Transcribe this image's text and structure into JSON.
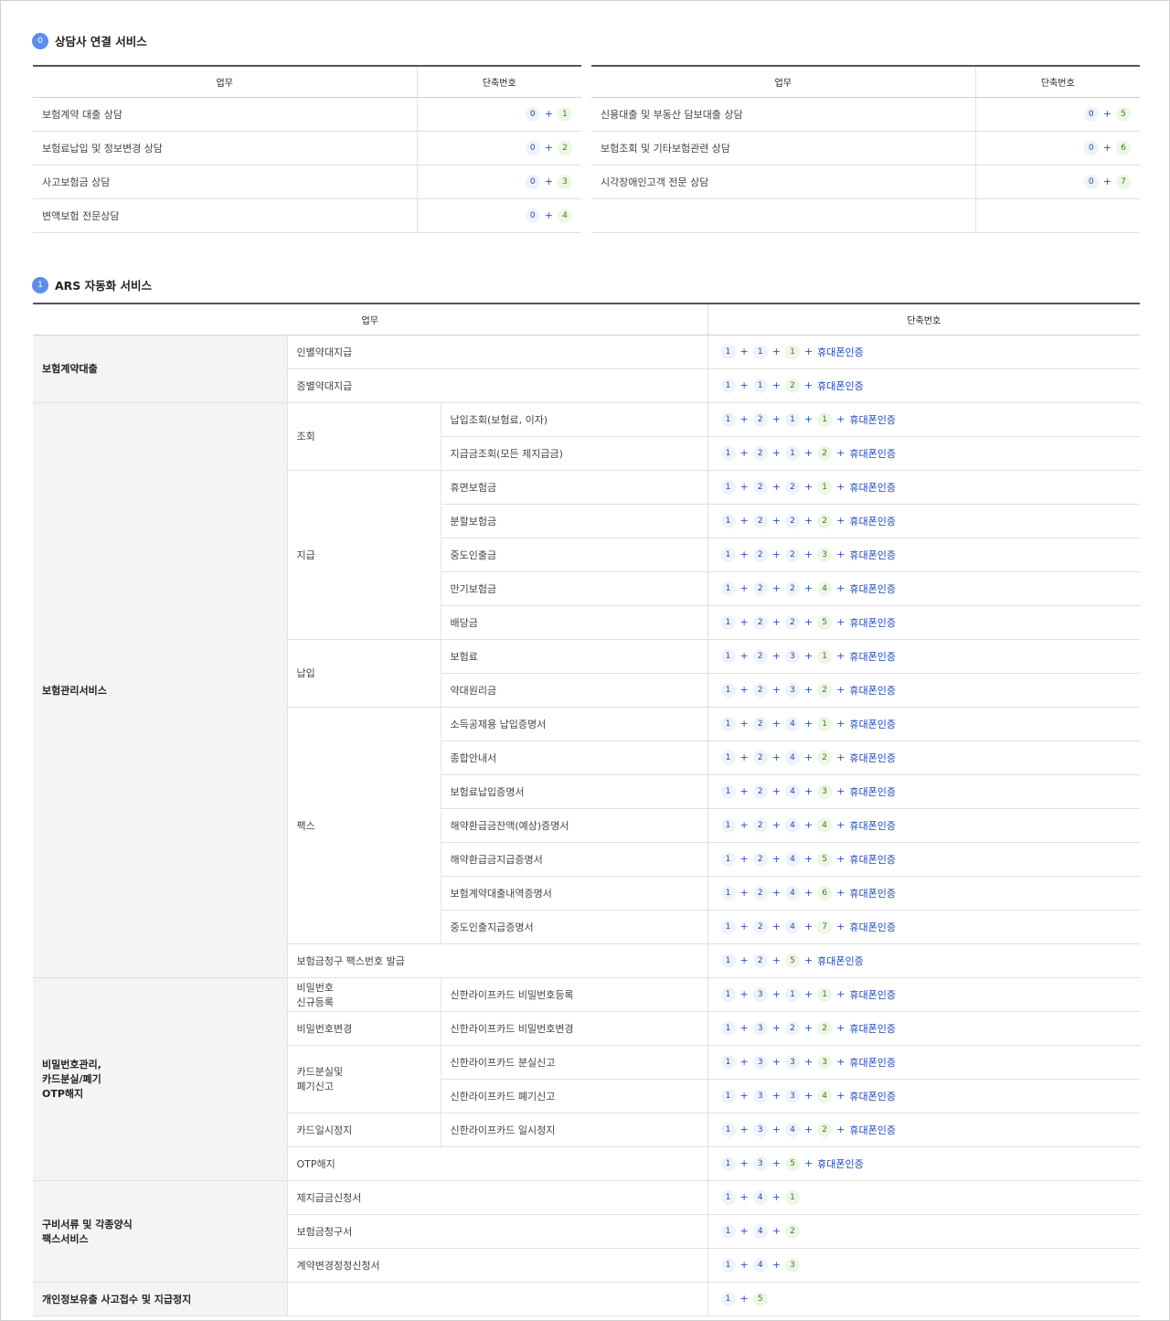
{
  "section0": {
    "badge": "0",
    "title": "상담사 연결 서비스",
    "col_task": "업무",
    "col_code": "단축번호",
    "left": [
      {
        "label": "보험계약 대출 상담",
        "code": [
          "0",
          "1"
        ]
      },
      {
        "label": "보험료납입 및 정보변경 상담",
        "code": [
          "0",
          "2"
        ]
      },
      {
        "label": "사고보험금 상담",
        "code": [
          "0",
          "3"
        ]
      },
      {
        "label": "변액보험 전문상담",
        "code": [
          "0",
          "4"
        ]
      }
    ],
    "right": [
      {
        "label": "신용대출 및 부동산 담보대출 상담",
        "code": [
          "0",
          "5"
        ]
      },
      {
        "label": "보험조회 및 기타보험관련 상담",
        "code": [
          "0",
          "6"
        ]
      },
      {
        "label": "시각장애인고객 전문 상담",
        "code": [
          "0",
          "7"
        ]
      },
      {
        "label": "",
        "code": []
      }
    ]
  },
  "section1": {
    "badge": "1",
    "title": "ARS 자동화 서비스",
    "col_task": "업무",
    "col_code": "단축번호",
    "phone_auth": "휴대폰인증",
    "rows": [
      {
        "cat": "보험계약대출",
        "sub": "인별약대지급",
        "item": null,
        "code": [
          "1",
          "1",
          "1"
        ],
        "phone": true
      },
      {
        "sub": "증별약대지급",
        "item": null,
        "code": [
          "1",
          "1",
          "2"
        ],
        "phone": true
      },
      {
        "cat": "보험관리서비스",
        "sub": "조회",
        "item": "납입조회(보험료, 이자)",
        "code": [
          "1",
          "2",
          "1",
          "1"
        ],
        "phone": true
      },
      {
        "item": "지급금조회(모든 제지급금)",
        "code": [
          "1",
          "2",
          "1",
          "2"
        ],
        "phone": true
      },
      {
        "sub": "지급",
        "item": "휴면보험금",
        "code": [
          "1",
          "2",
          "2",
          "1"
        ],
        "phone": true
      },
      {
        "item": "분할보험금",
        "code": [
          "1",
          "2",
          "2",
          "2"
        ],
        "phone": true
      },
      {
        "item": "중도인출금",
        "code": [
          "1",
          "2",
          "2",
          "3"
        ],
        "phone": true
      },
      {
        "item": "만기보험금",
        "code": [
          "1",
          "2",
          "2",
          "4"
        ],
        "phone": true
      },
      {
        "item": "배당금",
        "code": [
          "1",
          "2",
          "2",
          "5"
        ],
        "phone": true
      },
      {
        "sub": "납입",
        "item": "보험료",
        "code": [
          "1",
          "2",
          "3",
          "1"
        ],
        "phone": true
      },
      {
        "item": "약대원리금",
        "code": [
          "1",
          "2",
          "3",
          "2"
        ],
        "phone": true
      },
      {
        "sub": "팩스",
        "item": "소득공제용 납입증명서",
        "code": [
          "1",
          "2",
          "4",
          "1"
        ],
        "phone": true
      },
      {
        "item": "종합안내서",
        "code": [
          "1",
          "2",
          "4",
          "2"
        ],
        "phone": true
      },
      {
        "item": "보험료납입증명서",
        "code": [
          "1",
          "2",
          "4",
          "3"
        ],
        "phone": true
      },
      {
        "item": "해약환급금잔액(예상)증명서",
        "code": [
          "1",
          "2",
          "4",
          "4"
        ],
        "phone": true
      },
      {
        "item": "해약환급금지급증명서",
        "code": [
          "1",
          "2",
          "4",
          "5"
        ],
        "phone": true
      },
      {
        "item": "보험계약대출내역증명서",
        "code": [
          "1",
          "2",
          "4",
          "6"
        ],
        "phone": true
      },
      {
        "item": "중도인출지급증명서",
        "code": [
          "1",
          "2",
          "4",
          "7"
        ],
        "phone": true
      },
      {
        "sub": "보험금청구 팩스번호 발급",
        "item": null,
        "code": [
          "1",
          "2",
          "5"
        ],
        "phone": true
      },
      {
        "cat": "비밀번호관리,\n카드분실/폐기\nOTP해지",
        "sub": "비밀번호\n신규등록",
        "item": "신한라이프카드 비밀번호등록",
        "code": [
          "1",
          "3",
          "1",
          "1"
        ],
        "phone": true
      },
      {
        "sub": "비밀번호변경",
        "item": "신한라이프카드 비밀번호변경",
        "code": [
          "1",
          "3",
          "2",
          "2"
        ],
        "phone": true
      },
      {
        "sub": "카드분실및\n폐기신고",
        "item": "신한라이프카드 분실신고",
        "code": [
          "1",
          "3",
          "3",
          "3"
        ],
        "phone": true
      },
      {
        "item": "신한라이프카드 폐기신고",
        "code": [
          "1",
          "3",
          "3",
          "4"
        ],
        "phone": true
      },
      {
        "sub": "카드일시정지",
        "item": "신한라이프카드 일시정지",
        "code": [
          "1",
          "3",
          "4",
          "2"
        ],
        "phone": true
      },
      {
        "sub": "OTP해지",
        "item": null,
        "code": [
          "1",
          "3",
          "5"
        ],
        "phone": true
      },
      {
        "cat": "구비서류 및 각종양식\n팩스서비스",
        "sub": "제지급금신청서",
        "item": null,
        "code": [
          "1",
          "4",
          "1"
        ],
        "phone": false
      },
      {
        "sub": "보험금청구서",
        "item": null,
        "code": [
          "1",
          "4",
          "2"
        ],
        "phone": false
      },
      {
        "sub": "계약변경정정신청서",
        "item": null,
        "code": [
          "1",
          "4",
          "3"
        ],
        "phone": false
      },
      {
        "cat": "개인정보유출 사고접수 및 지급정지",
        "sub": "",
        "item": null,
        "code": [
          "1",
          "5"
        ],
        "phone": false
      }
    ]
  }
}
